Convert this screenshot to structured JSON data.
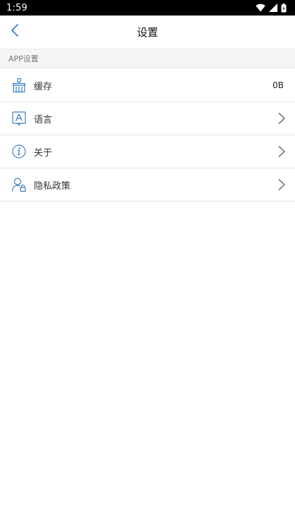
{
  "status_bar": {
    "time": "1:59",
    "icons": [
      "wifi-icon",
      "signal-icon",
      "battery-icon"
    ]
  },
  "header": {
    "title": "设置",
    "back_icon": "chevron-left-icon"
  },
  "section": {
    "label": "APP设置"
  },
  "settings": {
    "items": [
      {
        "label": "缓存",
        "icon": "broom-icon",
        "value": "0B"
      },
      {
        "label": "语言",
        "icon": "language-icon"
      },
      {
        "label": "关于",
        "icon": "info-icon"
      },
      {
        "label": "隐私政策",
        "icon": "user-lock-icon"
      }
    ]
  },
  "colors": {
    "accent": "#3a7fc4",
    "status_bar_bg": "#000000",
    "section_bg": "#f5f5f5",
    "divider": "#e6e6e6"
  }
}
